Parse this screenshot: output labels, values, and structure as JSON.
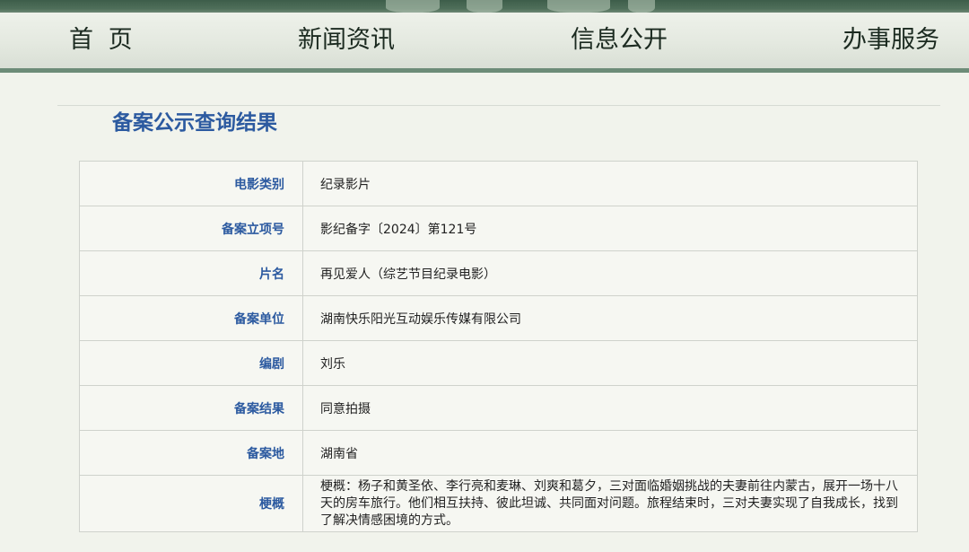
{
  "nav": {
    "items": [
      {
        "label": "首 页"
      },
      {
        "label": "新闻资讯"
      },
      {
        "label": "信息公开"
      },
      {
        "label": "办事服务"
      }
    ]
  },
  "page_title": "备案公示查询结果",
  "rows": [
    {
      "label": "电影类别",
      "value": "纪录影片"
    },
    {
      "label": "备案立项号",
      "value": "影纪备字〔2024〕第121号"
    },
    {
      "label": "片名",
      "value": "再见爱人（综艺节目纪录电影）"
    },
    {
      "label": "备案单位",
      "value": "湖南快乐阳光互动娱乐传媒有限公司"
    },
    {
      "label": "编剧",
      "value": "刘乐"
    },
    {
      "label": "备案结果",
      "value": "同意拍摄"
    },
    {
      "label": "备案地",
      "value": "湖南省"
    },
    {
      "label": "梗概",
      "value": "梗概：杨子和黄圣依、李行亮和麦琳、刘爽和葛夕，三对面临婚姻挑战的夫妻前往内蒙古，展开一场十八天的房车旅行。他们相互扶持、彼此坦诚、共同面对问题。旅程结束时，三对夫妻实现了自我成长，找到了解决情感困境的方式。"
    }
  ],
  "colors": {
    "accent": "#2c5aa0",
    "nav_line": "#6d8c78",
    "top_strip": "#3d5d4a"
  }
}
